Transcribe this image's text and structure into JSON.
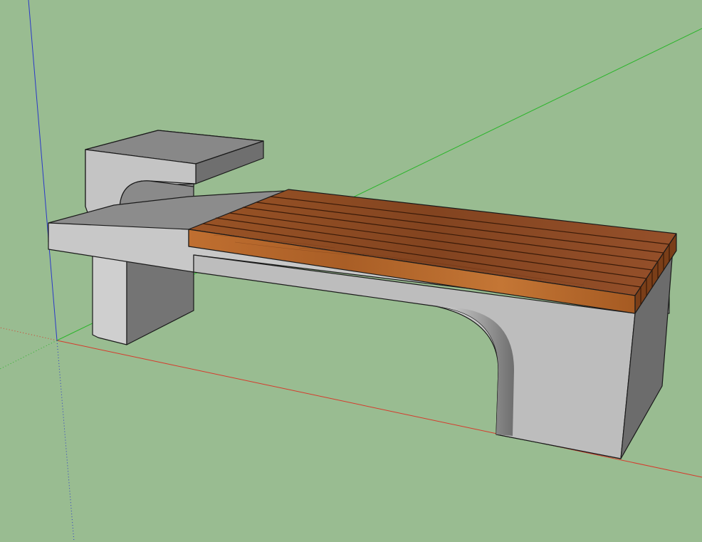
{
  "viewport": {
    "background": "#99bc91"
  },
  "axes": {
    "red_axis_color": "#d63a2c",
    "green_axis_color": "#2ab52a",
    "blue_axis_color": "#2a38c8"
  },
  "model": {
    "concrete_light": "#c9c9c9",
    "concrete_mid": "#a8a8a8",
    "concrete_dark": "#7a7a7a",
    "wood_top": "#8a4c22",
    "wood_front": "#b5682e",
    "wood_side": "#7a3e18"
  }
}
